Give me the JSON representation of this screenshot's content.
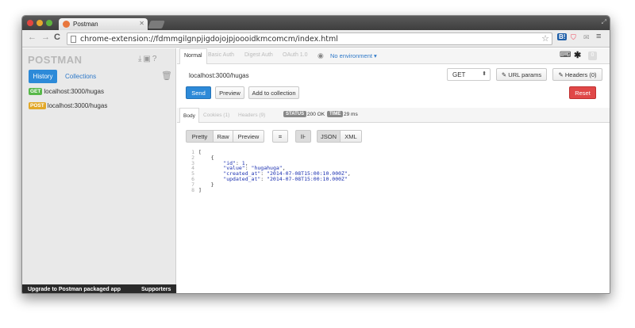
{
  "browser": {
    "tab_title": "Postman",
    "url": "chrome-extension://fdmmgilgnpjigdojojpjoooidkmcomcm/index.html",
    "ext_badge": "B!"
  },
  "sidebar": {
    "brand": "POSTMAN",
    "tabs": {
      "history": "History",
      "collections": "Collections"
    },
    "history": [
      {
        "method": "GET",
        "url": "localhost:3000/hugas"
      },
      {
        "method": "POST",
        "url": "localhost:3000/hugas"
      }
    ],
    "footer": {
      "upgrade": "Upgrade to Postman packaged app",
      "supporters": "Supporters"
    },
    "collapse_glyph": "«"
  },
  "request": {
    "tabs": [
      "Normal",
      "Basic Auth",
      "Digest Auth",
      "OAuth 1.0"
    ],
    "environment": "No environment",
    "zero_badge": "0",
    "url": "localhost:3000/hugas",
    "method": "GET",
    "url_params_label": "URL params",
    "headers_label": "Headers (0)",
    "send_label": "Send",
    "preview_label": "Preview",
    "add_collection_label": "Add to collection",
    "reset_label": "Reset"
  },
  "response": {
    "tabs": [
      "Body",
      "Cookies (1)",
      "Headers (9)"
    ],
    "status_label": "STATUS",
    "status_value": "200 OK",
    "time_label": "TIME",
    "time_value": "29 ms",
    "format_buttons": [
      "Pretty",
      "Raw",
      "Preview"
    ],
    "type_buttons": [
      "JSON",
      "XML"
    ],
    "line_numbers": [
      "1",
      "2",
      "3",
      "4",
      "5",
      "6",
      "7",
      "8"
    ],
    "body": {
      "id": "1",
      "value": "\"hugahuga\"",
      "created_at": "\"2014-07-08T15:00:10.000Z\"",
      "updated_at": "\"2014-07-08T15:00:10.000Z\""
    }
  },
  "colors": {
    "accent": "#2d8ad8",
    "get": "#58b84a",
    "post": "#e2a829",
    "reset": "#e04848"
  }
}
